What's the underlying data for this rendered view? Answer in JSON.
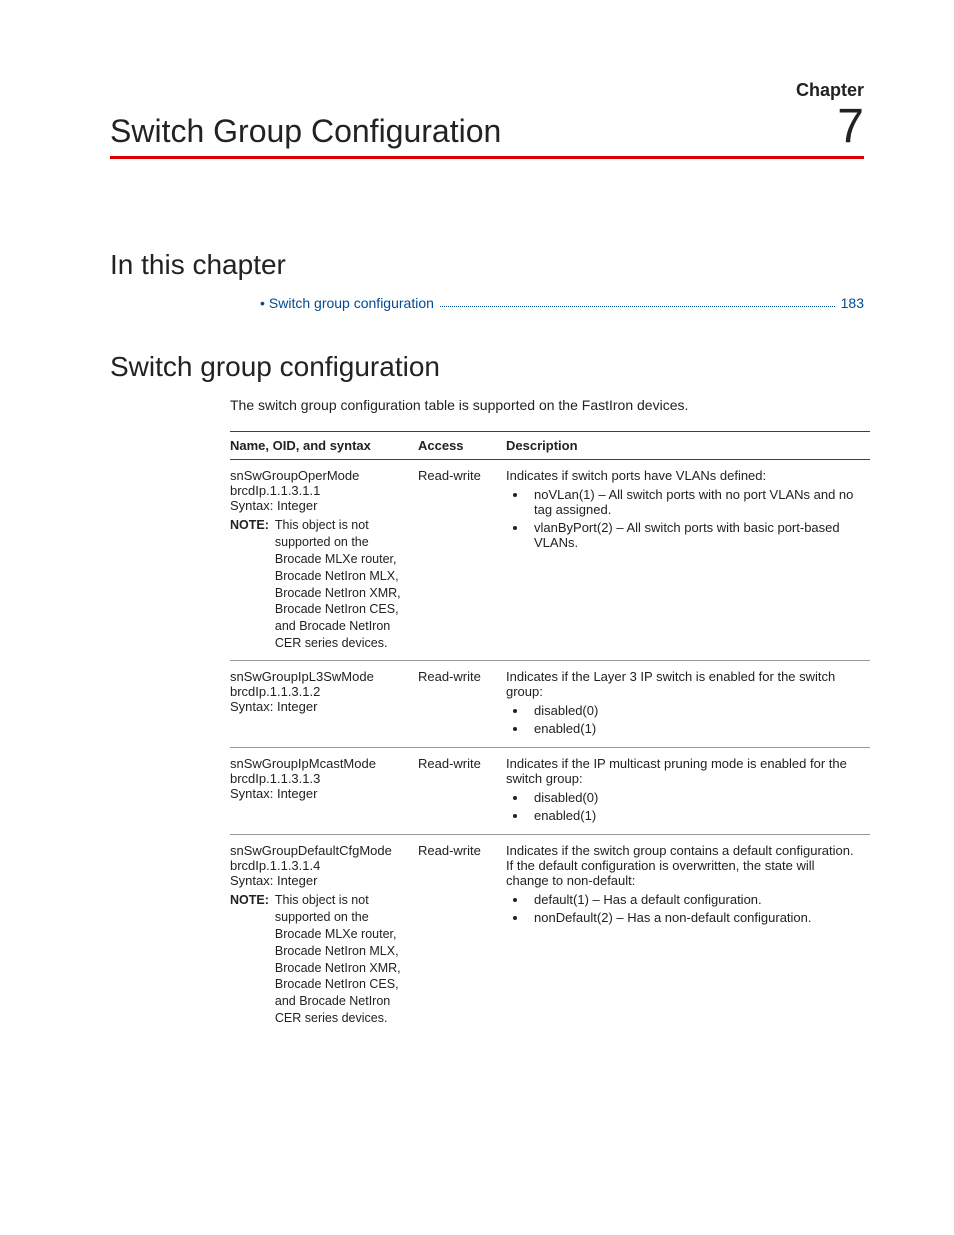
{
  "header": {
    "chapter_label": "Chapter",
    "title": "Switch Group Configuration",
    "number": "7"
  },
  "sections": {
    "in_this_chapter": {
      "heading": "In this chapter",
      "toc": [
        {
          "label": "Switch group configuration",
          "page": "183"
        }
      ]
    },
    "switch_group_config": {
      "heading": "Switch group configuration",
      "intro": "The switch group configuration table is supported on the FastIron devices.",
      "columns": {
        "name": "Name, OID, and syntax",
        "access": "Access",
        "description": "Description"
      },
      "note_label": "NOTE:",
      "note_unsupported": "This object is not supported on the Brocade MLXe router, Brocade NetIron MLX, Brocade NetIron XMR, Brocade NetIron CES, and Brocade NetIron CER series devices.",
      "rows": [
        {
          "name": "snSwGroupOperMode",
          "oid": "brcdIp.1.1.3.1.1",
          "syntax": "Syntax: Integer",
          "has_note": true,
          "access": "Read-write",
          "desc": "Indicates if switch ports have VLANs defined:",
          "bullets": [
            "noVLan(1) – All switch ports with no port VLANs and no tag assigned.",
            "vlanByPort(2) – All switch ports with basic port-based VLANs."
          ]
        },
        {
          "name": "snSwGroupIpL3SwMode",
          "oid": "brcdIp.1.1.3.1.2",
          "syntax": "Syntax: Integer",
          "has_note": false,
          "access": "Read-write",
          "desc": "Indicates if the Layer 3 IP switch is enabled for the switch group:",
          "bullets": [
            "disabled(0)",
            "enabled(1)"
          ]
        },
        {
          "name": "snSwGroupIpMcastMode",
          "oid": "brcdIp.1.1.3.1.3",
          "syntax": "Syntax: Integer",
          "has_note": false,
          "access": "Read-write",
          "desc": "Indicates if the IP multicast pruning mode is enabled for the switch group:",
          "bullets": [
            "disabled(0)",
            "enabled(1)"
          ]
        },
        {
          "name": "snSwGroupDefaultCfgMode",
          "oid": "brcdIp.1.1.3.1.4",
          "syntax": "Syntax: Integer",
          "has_note": true,
          "access": "Read-write",
          "desc": "Indicates if the switch group contains a default configuration. If the default configuration is overwritten, the state will change to non-default:",
          "bullets": [
            "default(1) – Has a default configuration.",
            "nonDefault(2) – Has a non-default configuration."
          ]
        }
      ]
    }
  }
}
